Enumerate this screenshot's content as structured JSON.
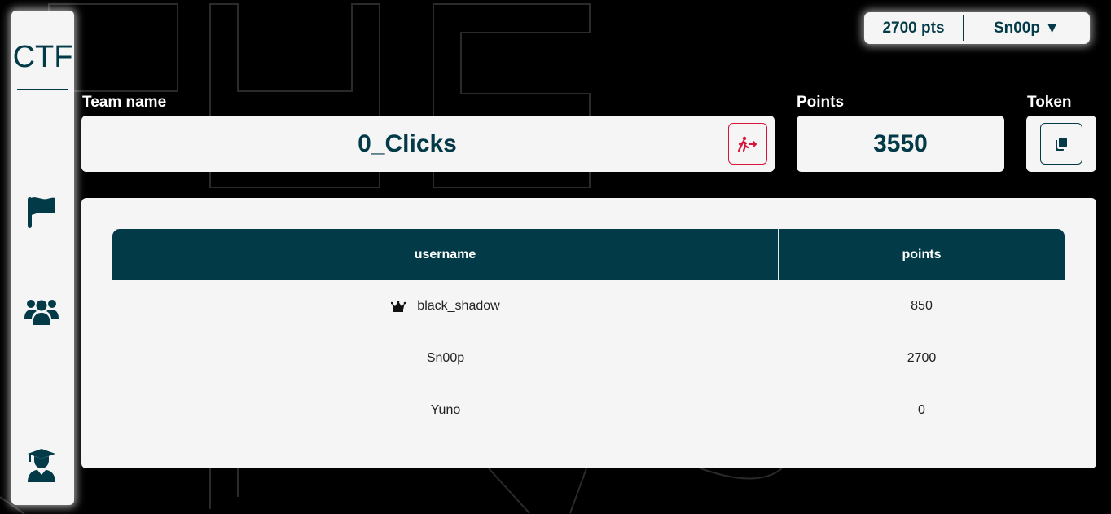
{
  "sidebar": {
    "logo": "CTF",
    "icons": [
      "flag-icon",
      "users-icon",
      "graduate-icon"
    ]
  },
  "header": {
    "points": "2700 pts",
    "username": "Sn00p ▼"
  },
  "team": {
    "name_label": "Team name",
    "name": "0_Clicks",
    "points_label": "Points",
    "points": "3550",
    "token_label": "Token"
  },
  "members": {
    "columns": [
      "username",
      "points"
    ],
    "rows": [
      {
        "username": "black_shadow",
        "points": "850",
        "captain": true
      },
      {
        "username": "Sn00p",
        "points": "2700",
        "captain": false
      },
      {
        "username": "Yuno",
        "points": "0",
        "captain": false
      }
    ]
  },
  "colors": {
    "primary": "#023a47",
    "danger": "#d9143a",
    "card": "#f5f5f5",
    "background": "#000000"
  }
}
